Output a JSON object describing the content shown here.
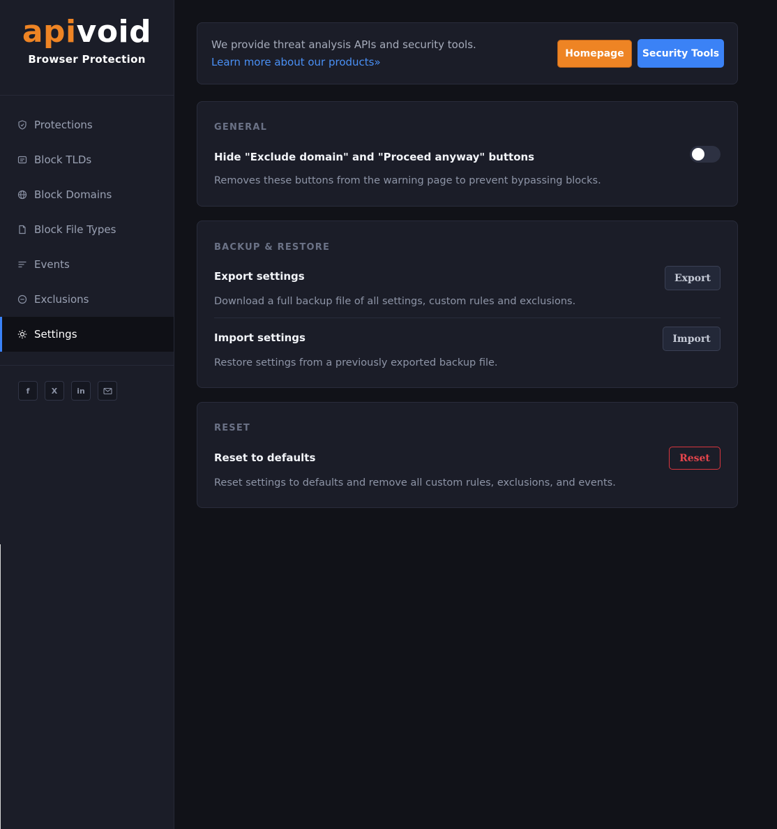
{
  "brand": {
    "logo_part1": "api",
    "logo_part2": "void",
    "subtitle": "Browser Protection",
    "accent_color": "#ee8424"
  },
  "sidebar": {
    "items": [
      {
        "label": "Protections",
        "icon": "shield-icon"
      },
      {
        "label": "Block TLDs",
        "icon": "tag-icon"
      },
      {
        "label": "Block Domains",
        "icon": "globe-icon"
      },
      {
        "label": "Block File Types",
        "icon": "file-icon"
      },
      {
        "label": "Events",
        "icon": "list-icon"
      },
      {
        "label": "Exclusions",
        "icon": "minus-circle-icon"
      },
      {
        "label": "Settings",
        "icon": "gear-icon",
        "active": true
      }
    ],
    "socials": [
      {
        "label": "f",
        "icon": "facebook-icon"
      },
      {
        "label": "X",
        "icon": "x-icon"
      },
      {
        "label": "in",
        "icon": "linkedin-icon"
      },
      {
        "label": "",
        "icon": "mail-icon"
      }
    ]
  },
  "banner": {
    "text": "We provide threat analysis APIs and security tools.",
    "link": "Learn more about our products»",
    "homepage_label": "Homepage",
    "security_tools_label": "Security Tools"
  },
  "general": {
    "title": "GENERAL",
    "setting_title": "Hide \"Exclude domain\" and \"Proceed anyway\" buttons",
    "setting_desc": "Removes these buttons from the warning page to prevent bypassing blocks.",
    "toggle_on": false
  },
  "backup": {
    "title": "BACKUP & RESTORE",
    "export_title": "Export settings",
    "export_desc": "Download a full backup file of all settings, custom rules and exclusions.",
    "export_label": "Export",
    "import_title": "Import settings",
    "import_desc": "Restore settings from a previously exported backup file.",
    "import_label": "Import"
  },
  "reset": {
    "title": "RESET",
    "setting_title": "Reset to defaults",
    "setting_desc": "Reset settings to defaults and remove all custom rules, exclusions, and events.",
    "reset_label": "Reset",
    "danger_color": "#e5454c"
  }
}
